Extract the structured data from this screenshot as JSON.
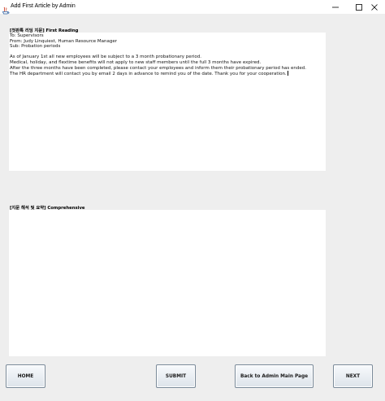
{
  "window": {
    "title": "Add First Article by Admin"
  },
  "article_section": {
    "label": "[첫판톡 리딩 지문] First Reading",
    "lines": [
      "To: Supervisors",
      "From: Judy Linquiest, Human Resource Manager",
      "Sub: Probation periods",
      "",
      "As of January 1st all new employees will be subject to a 3 month probationary period.",
      "Medical, holiday, and flextime benefits will not apply to new staff members until the full 3 months have expired.",
      "After the three months have been completed, please contact your employees and inform them their probationary period has ended.",
      "The HR department will contact you by email 2 days in advance to remind you of the date. Thank you for your cooperation."
    ]
  },
  "comprehensive_section": {
    "label": "[지문 해석 및 요약] Comprehensive",
    "value": ""
  },
  "buttons": {
    "home": "HOME",
    "submit": "SUBMIT",
    "back": "Back to Admin Main Page",
    "next": "NEXT"
  }
}
